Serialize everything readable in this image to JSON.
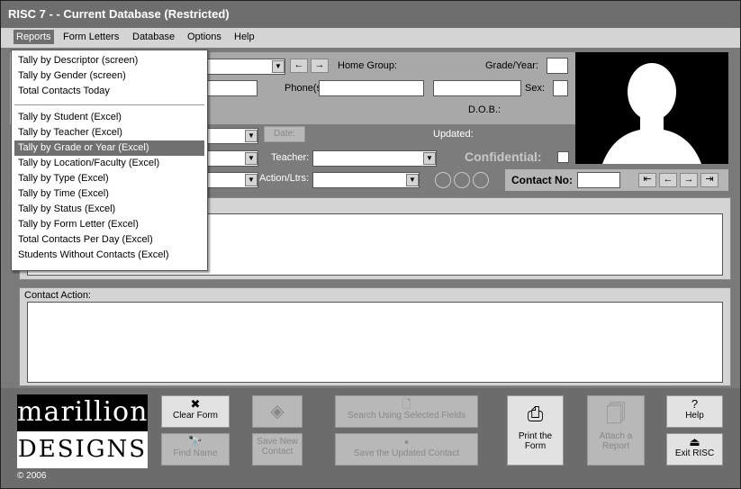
{
  "window": {
    "title": "RISC 7 -  - Current Database (Restricted)"
  },
  "menubar": [
    "Reports",
    "Form Letters",
    "Database",
    "Options",
    "Help"
  ],
  "reports_menu": {
    "group1": [
      "Tally by Descriptor (screen)",
      "Tally by Gender (screen)",
      "Total Contacts Today"
    ],
    "group2": [
      "Tally by Student (Excel)",
      "Tally by Teacher (Excel)",
      "Tally by Grade or Year (Excel)",
      "Tally by Location/Faculty (Excel)",
      "Tally by Type (Excel)",
      "Tally by Time (Excel)",
      "Tally by Status (Excel)",
      "Tally by Form Letter (Excel)",
      "Total Contacts Per Day (Excel)",
      "Students Without Contacts (Excel)"
    ],
    "selected": "Tally by Grade or Year (Excel)"
  },
  "form": {
    "home_group_label": "Home Group:",
    "grade_year_label": "Grade/Year:",
    "phones_label": "Phone(s):",
    "sex_label": "Sex:",
    "dob_label": "D.O.B.:",
    "date_label": "Date:",
    "updated_label": "Updated:",
    "teacher_label": "Teacher:",
    "confidential_label": "Confidential:",
    "action_label": "Action/Ltrs:",
    "contact_no_label": "Contact No:",
    "contact_action_label": "Contact Action:"
  },
  "buttons": {
    "clear_form": "Clear Form",
    "find_name": "Find Name",
    "save_new": [
      "Save New",
      "Contact"
    ],
    "search": "Search Using Selected Fields",
    "save_updated": "Save the Updated Contact",
    "print": [
      "Print the",
      "Form"
    ],
    "attach": [
      "Attach a",
      "Report"
    ],
    "help": "Help",
    "exit": "Exit RISC"
  },
  "logo": {
    "top": "marillion",
    "bottom": "DESIGNS"
  },
  "copyright": "© 2006"
}
